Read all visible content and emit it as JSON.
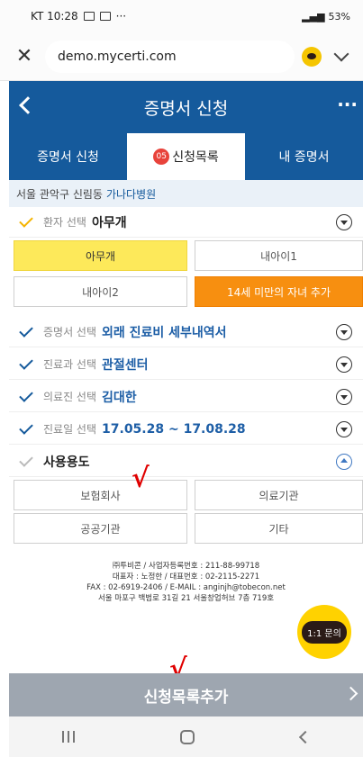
{
  "status_bar": {
    "carrier_time": "KT 10:28",
    "right_text": "53%"
  },
  "browser": {
    "url": "demo.mycerti.com"
  },
  "header": {
    "title": "증명서 신청"
  },
  "tabs": [
    {
      "label": "증명서 신청"
    },
    {
      "badge": "05",
      "label": "신청목록"
    },
    {
      "label": "내 증명서"
    }
  ],
  "hospital": {
    "region": "서울 관악구 신림동",
    "name": "가나다병원"
  },
  "patient": {
    "label": "환자 선택",
    "value": "아무개",
    "options": [
      "아무개",
      "내아이1",
      "내아이2",
      "14세 미만의 자녀 추가"
    ]
  },
  "certificate": {
    "label": "증명서 선택",
    "value": "외래 진료비 세부내역서"
  },
  "department": {
    "label": "진료과 선택",
    "value": "관절센터"
  },
  "doctor": {
    "label": "의료진 선택",
    "value": "김대한"
  },
  "treatment_date": {
    "label": "진료일 선택",
    "value": "17.05.28 ~ 17.08.28"
  },
  "usage": {
    "label": "사용용도",
    "options": [
      "보험회사",
      "의료기관",
      "공공기관",
      "기타"
    ]
  },
  "annotations": {
    "check_mark": "√"
  },
  "footer": {
    "line1": "㈜투비콘 / 사업자등록번호 : 211-88-99718",
    "line2": "대표자 : 노정한 / 대표번호 : 02-2115-2271",
    "line3": "FAX : 02-6919-2406 / E-MAIL : anginjh@tobecon.net",
    "line4": "서울 마포구 백범로 31길 21 서울창업허브 7층 719호"
  },
  "chat": {
    "label": "1:1 문의"
  },
  "cta": {
    "label": "신청목록추가"
  }
}
